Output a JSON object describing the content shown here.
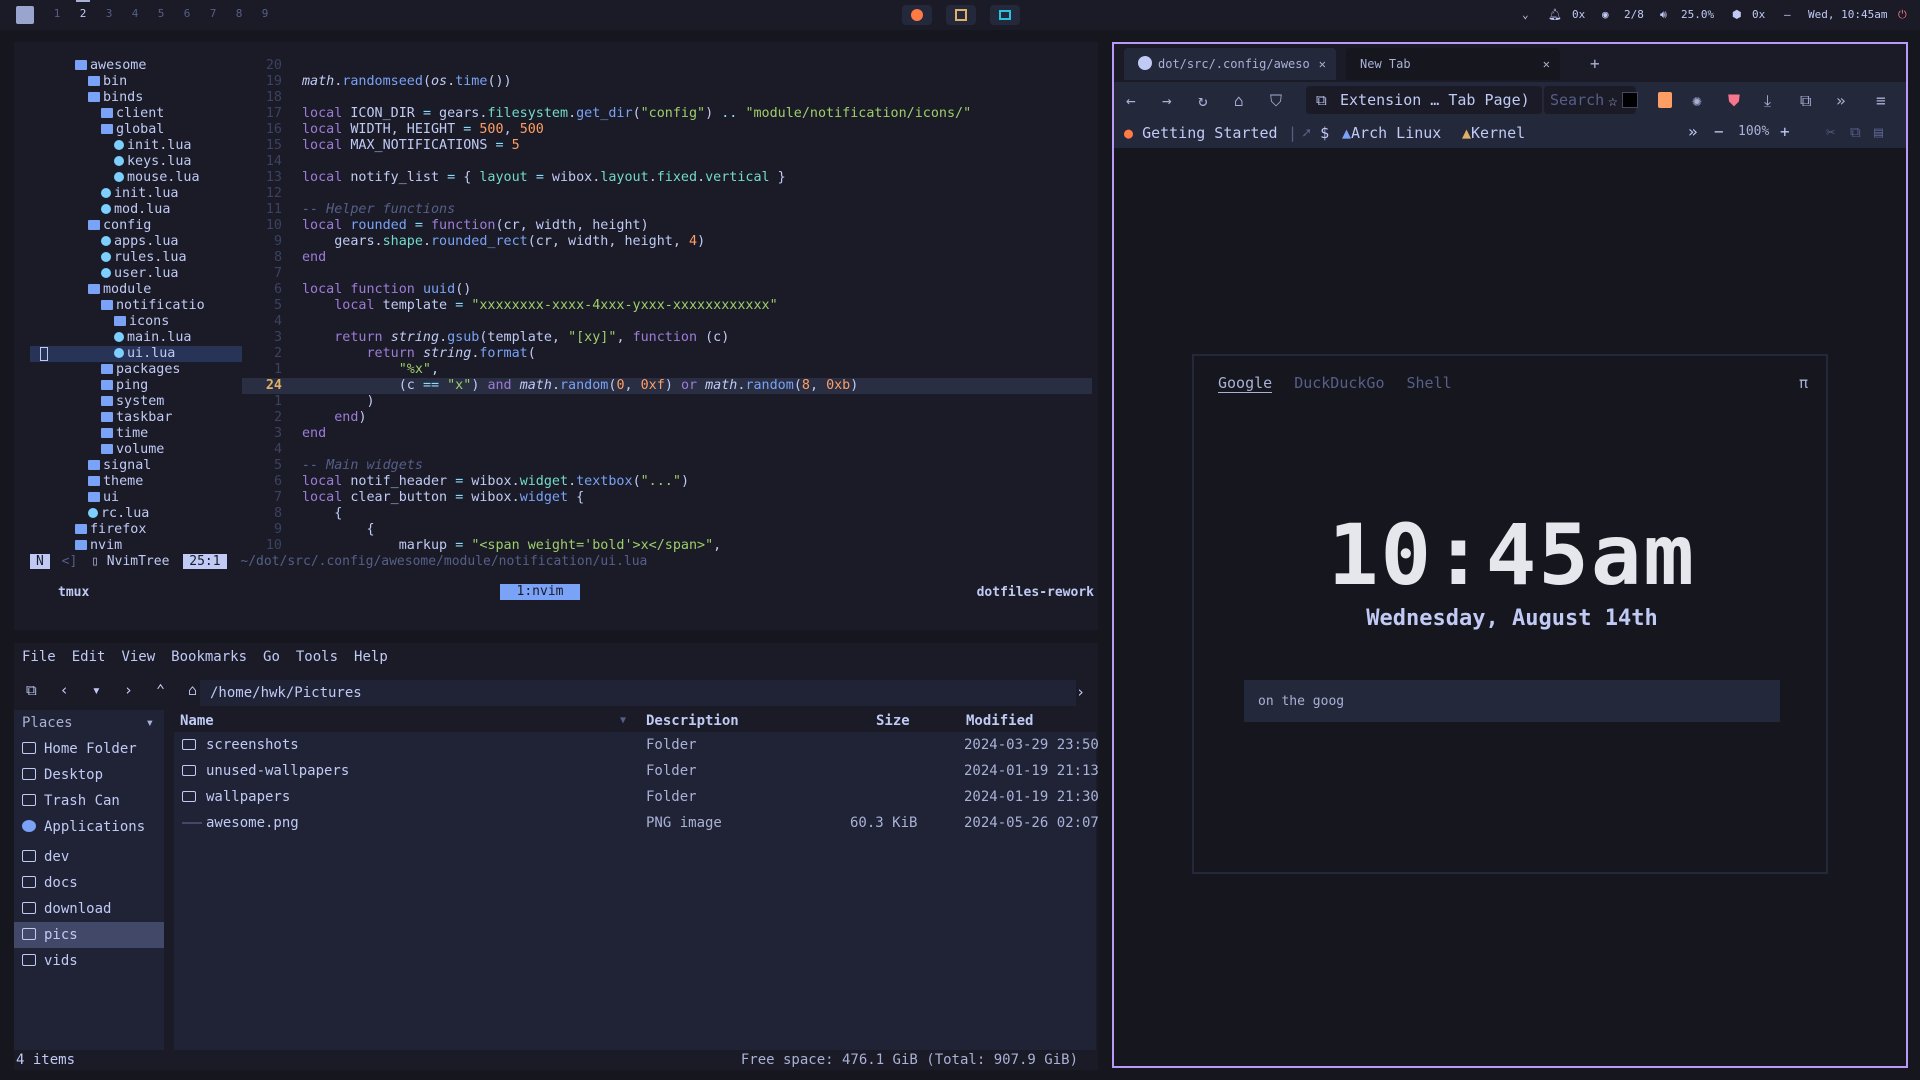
{
  "topbar": {
    "tags": [
      "1",
      "2",
      "3",
      "4",
      "5",
      "6",
      "7",
      "8",
      "9"
    ],
    "active_tag": "2",
    "notif": "0x",
    "updates": "2/8",
    "volume": "25.0%",
    "pkgs": "0x",
    "dash": "–",
    "clock": "Wed, 10:45am"
  },
  "term": {
    "tree": [
      {
        "d": 3,
        "t": "awesome",
        "k": "f"
      },
      {
        "d": 4,
        "t": "bin",
        "k": "f"
      },
      {
        "d": 4,
        "t": "binds",
        "k": "f"
      },
      {
        "d": 5,
        "t": "client",
        "k": "f"
      },
      {
        "d": 5,
        "t": "global",
        "k": "f"
      },
      {
        "d": 6,
        "t": "init.lua",
        "k": "l"
      },
      {
        "d": 6,
        "t": "keys.lua",
        "k": "l"
      },
      {
        "d": 6,
        "t": "mouse.lua",
        "k": "l"
      },
      {
        "d": 5,
        "t": "init.lua",
        "k": "l"
      },
      {
        "d": 5,
        "t": "mod.lua",
        "k": "l"
      },
      {
        "d": 4,
        "t": "config",
        "k": "f"
      },
      {
        "d": 5,
        "t": "apps.lua",
        "k": "l"
      },
      {
        "d": 5,
        "t": "rules.lua",
        "k": "l"
      },
      {
        "d": 5,
        "t": "user.lua",
        "k": "l"
      },
      {
        "d": 4,
        "t": "module",
        "k": "f"
      },
      {
        "d": 5,
        "t": "notificatio",
        "k": "f"
      },
      {
        "d": 6,
        "t": "icons",
        "k": "f"
      },
      {
        "d": 6,
        "t": "main.lua",
        "k": "l"
      },
      {
        "d": 6,
        "t": "ui.lua",
        "k": "l",
        "sel": true
      },
      {
        "d": 5,
        "t": "packages",
        "k": "f"
      },
      {
        "d": 5,
        "t": "ping",
        "k": "f"
      },
      {
        "d": 5,
        "t": "system",
        "k": "f"
      },
      {
        "d": 5,
        "t": "taskbar",
        "k": "f"
      },
      {
        "d": 5,
        "t": "time",
        "k": "f"
      },
      {
        "d": 5,
        "t": "volume",
        "k": "f"
      },
      {
        "d": 4,
        "t": "signal",
        "k": "f"
      },
      {
        "d": 4,
        "t": "theme",
        "k": "f"
      },
      {
        "d": 4,
        "t": "ui",
        "k": "f"
      },
      {
        "d": 4,
        "t": "rc.lua",
        "k": "l"
      },
      {
        "d": 3,
        "t": "firefox",
        "k": "f"
      },
      {
        "d": 3,
        "t": "nvim",
        "k": "f"
      }
    ],
    "code": [
      {
        "n": "20",
        "h": ""
      },
      {
        "n": "19",
        "h": "<span class='it'>math</span>.<span class='fn'>randomseed</span>(<span class='it'>os</span>.<span class='fn'>time</span>())"
      },
      {
        "n": "18",
        "h": ""
      },
      {
        "n": "17",
        "h": "<span class='kw'>local</span> ICON_DIR <span class='op'>=</span> gears.<span class='pr'>filesystem</span>.<span class='fn'>get_dir</span>(<span class='str'>\"config\"</span>) <span class='op'>..</span> <span class='str'>\"module/notification/icons/\"</span>"
      },
      {
        "n": "16",
        "h": "<span class='kw'>local</span> WIDTH, HEIGHT <span class='op'>=</span> <span class='num'>500</span>, <span class='num'>500</span>"
      },
      {
        "n": "15",
        "h": "<span class='kw'>local</span> MAX_NOTIFICATIONS <span class='op'>=</span> <span class='num'>5</span>"
      },
      {
        "n": "14",
        "h": ""
      },
      {
        "n": "13",
        "h": "<span class='kw'>local</span> notify_list <span class='op'>=</span> { <span class='pr'>layout</span> <span class='op'>=</span> wibox.<span class='pr'>layout</span>.<span class='pr'>fixed</span>.<span class='pr'>vertical</span> }"
      },
      {
        "n": "12",
        "h": ""
      },
      {
        "n": "11",
        "h": "<span class='cm'>-- Helper functions</span>"
      },
      {
        "n": "10",
        "h": "<span class='kw'>local</span> <span class='fn'>rounded</span> <span class='op'>=</span> <span class='kw'>function</span>(cr, width, height)"
      },
      {
        "n": "9",
        "h": "    gears.<span class='pr'>shape</span>.<span class='fn'>rounded_rect</span>(cr, width, height, <span class='num'>4</span>)"
      },
      {
        "n": "8",
        "h": "<span class='kw'>end</span>"
      },
      {
        "n": "7",
        "h": ""
      },
      {
        "n": "6",
        "h": "<span class='kw'>local</span> <span class='kw'>function</span> <span class='fn'>uuid</span>()"
      },
      {
        "n": "5",
        "h": "    <span class='kw'>local</span> template <span class='op'>=</span> <span class='str'>\"xxxxxxxx-xxxx-4xxx-yxxx-xxxxxxxxxxxx\"</span>"
      },
      {
        "n": "4",
        "h": ""
      },
      {
        "n": "3",
        "h": "    <span class='kw'>return</span> <span class='it'>string</span>.<span class='fn'>gsub</span>(template, <span class='str'>\"[xy]\"</span>, <span class='kw'>function</span> (c)"
      },
      {
        "n": "2",
        "h": "        <span class='kw'>return</span> <span class='it'>string</span>.<span class='fn'>format</span>("
      },
      {
        "n": "1",
        "h": "            <span class='str'>\"%x\"</span>,"
      },
      {
        "n": "24",
        "h": "            (c <span class='op'>==</span> <span class='str'>\"x\"</span>) <span class='kw'>and</span> <span class='it'>math</span>.<span class='fn'>random</span>(<span class='num'>0</span>, <span class='num'>0xf</span>) <span class='kw'>or</span> <span class='it'>math</span>.<span class='fn'>random</span>(<span class='num'>8</span>, <span class='num'>0xb</span>)",
        "cur": true
      },
      {
        "n": "1",
        "h": "        )"
      },
      {
        "n": "2",
        "h": "    <span class='kw'>end</span>)"
      },
      {
        "n": "3",
        "h": "<span class='kw'>end</span>"
      },
      {
        "n": "4",
        "h": ""
      },
      {
        "n": "5",
        "h": "<span class='cm'>-- Main widgets</span>"
      },
      {
        "n": "6",
        "h": "<span class='kw'>local</span> notif_header <span class='op'>=</span> wibox.<span class='pr'>widget</span>.<span class='fn'>textbox</span>(<span class='str'>\"...\"</span>)"
      },
      {
        "n": "7",
        "h": "<span class='kw'>local</span> clear_button <span class='op'>=</span> wibox.<span class='fn'>widget</span> {"
      },
      {
        "n": "8",
        "h": "    {"
      },
      {
        "n": "9",
        "h": "        {"
      },
      {
        "n": "10",
        "h": "            markup <span class='op'>=</span> <span class='str'>\"&lt;span weight='bold'&gt;x&lt;/span&gt;\"</span>,"
      }
    ],
    "status_mode": "N",
    "status_sep": "<]",
    "status_tree": "NvimTree",
    "status_pos": "25:1",
    "status_path": "~/dot/src/.config/awesome/module/notification/ui.lua",
    "tmux_left": "tmux",
    "tmux_win": "1:nvim",
    "tmux_right": "dotfiles-rework"
  },
  "fm": {
    "menu": [
      "File",
      "Edit",
      "View",
      "Bookmarks",
      "Go",
      "Tools",
      "Help"
    ],
    "path": "/home/hwk/Pictures",
    "places_label": "Places",
    "places": [
      {
        "t": "Home Folder",
        "i": "home-icon"
      },
      {
        "t": "Desktop",
        "i": "desktop-icon"
      },
      {
        "t": "Trash Can",
        "i": "trash-icon"
      },
      {
        "t": "Applications",
        "i": "applications-icon"
      },
      {
        "t": "dev",
        "i": "folder-icon"
      },
      {
        "t": "docs",
        "i": "document-icon"
      },
      {
        "t": "download",
        "i": "download-icon"
      },
      {
        "t": "pics",
        "i": "image-icon",
        "sel": true
      },
      {
        "t": "vids",
        "i": "video-icon"
      }
    ],
    "columns": [
      "Name",
      "Description",
      "Size",
      "Modified"
    ],
    "rows": [
      {
        "name": "screenshots",
        "desc": "Folder",
        "size": "",
        "mod": "2024-03-29 23:50",
        "f": true
      },
      {
        "name": "unused-wallpapers",
        "desc": "Folder",
        "size": "",
        "mod": "2024-01-19 21:13",
        "f": true
      },
      {
        "name": "wallpapers",
        "desc": "Folder",
        "size": "",
        "mod": "2024-01-19 21:30",
        "f": true
      },
      {
        "name": "awesome.png",
        "desc": "PNG image",
        "size": "60.3 KiB",
        "mod": "2024-05-26 02:07",
        "f": false
      }
    ],
    "count": "4 items",
    "free": "Free space: 476.1 GiB (Total: 907.9 GiB)"
  },
  "ff": {
    "tab1": "dot/src/.config/aweso",
    "tab2": "New Tab",
    "url": "Extension … Tab Page)",
    "search": "Search",
    "bookmarks": [
      "Getting Started",
      "$",
      "Arch Linux",
      "Kernel"
    ],
    "zoom": "100%",
    "engines": [
      "Google",
      "DuckDuckGo",
      "Shell"
    ],
    "pi": "π",
    "time": "10:45am",
    "date": "Wednesday, August 14th",
    "input_value": "on the goog"
  }
}
